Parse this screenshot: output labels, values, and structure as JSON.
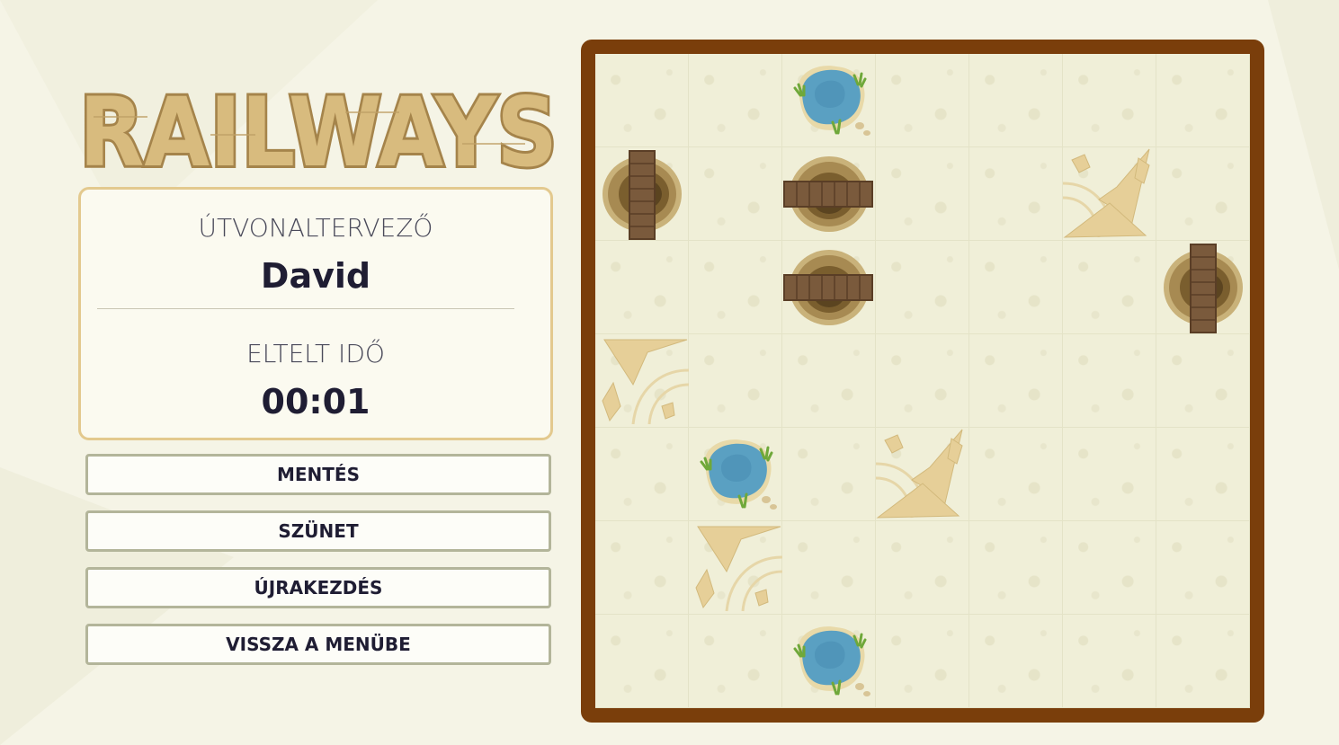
{
  "logo": {
    "text": "RAILWAYS"
  },
  "info": {
    "planner_label": "ÚTVONALTERVEZŐ",
    "player_name": "David",
    "elapsed_label": "ELTELT IDŐ",
    "elapsed_time": "00:01"
  },
  "buttons": {
    "save": "MENTÉS",
    "pause": "SZÜNET",
    "restart": "ÚJRAKEZDÉS",
    "back_to_menu": "VISSZA A MENÜBE"
  },
  "board": {
    "size": 7,
    "cells": [
      [
        "empty",
        "empty",
        "oasis",
        "empty",
        "empty",
        "empty",
        "empty"
      ],
      [
        "bridge-vertical",
        "empty",
        "bridge-horizontal",
        "empty",
        "empty",
        "mountain-a",
        "empty"
      ],
      [
        "empty",
        "empty",
        "bridge-horizontal",
        "empty",
        "empty",
        "empty",
        "bridge-vertical"
      ],
      [
        "mountain-b",
        "empty",
        "empty",
        "empty",
        "empty",
        "empty",
        "empty"
      ],
      [
        "empty",
        "oasis",
        "empty",
        "mountain-a",
        "empty",
        "empty",
        "empty"
      ],
      [
        "empty",
        "mountain-b",
        "empty",
        "empty",
        "empty",
        "empty",
        "empty"
      ],
      [
        "empty",
        "empty",
        "oasis",
        "empty",
        "empty",
        "empty",
        "empty"
      ]
    ]
  },
  "colors": {
    "board_frame": "#7a3e0b",
    "card_border": "#e3c98e",
    "button_border": "#b3b59a",
    "logo_fill": "#d6b77a",
    "logo_stroke": "#a07e45"
  }
}
